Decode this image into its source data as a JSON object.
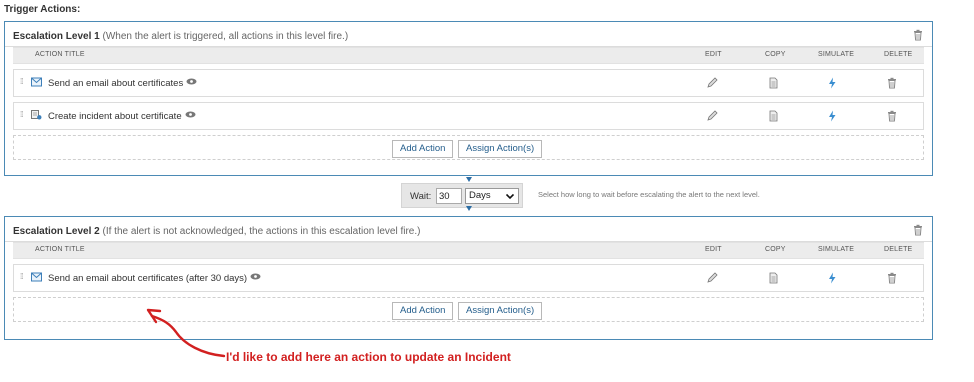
{
  "section_title": "Trigger Actions:",
  "columns": {
    "title": "ACTION TITLE",
    "edit": "EDIT",
    "copy": "COPY",
    "simulate": "SIMULATE",
    "delete": "DELETE"
  },
  "level1": {
    "name": "Escalation Level 1",
    "description": " (When the alert is triggered, all actions in this level fire.)",
    "actions": [
      {
        "label": "Send an email about certificates",
        "type_icon": "email-icon"
      },
      {
        "label": "Create incident about certificate",
        "type_icon": "incident-icon"
      }
    ],
    "add_label": "Add Action",
    "assign_label": "Assign Action(s)"
  },
  "wait": {
    "label": "Wait:",
    "value": "30",
    "unit": "Days",
    "hint": "Select how long to wait before escalating the alert to the next level."
  },
  "level2": {
    "name": "Escalation Level 2",
    "description": " (If the alert is not acknowledged, the actions in this escalation level fire.)",
    "actions": [
      {
        "label": "Send an email about certificates (after 30 days)",
        "type_icon": "email-icon"
      }
    ],
    "add_label": "Add Action",
    "assign_label": "Assign Action(s)"
  },
  "annotation": "I'd like to add here an action to update an Incident",
  "colors": {
    "border": "#4b8ab5",
    "link": "#245e8c",
    "annotation": "#d22020",
    "simulate": "#3a8ed0"
  }
}
